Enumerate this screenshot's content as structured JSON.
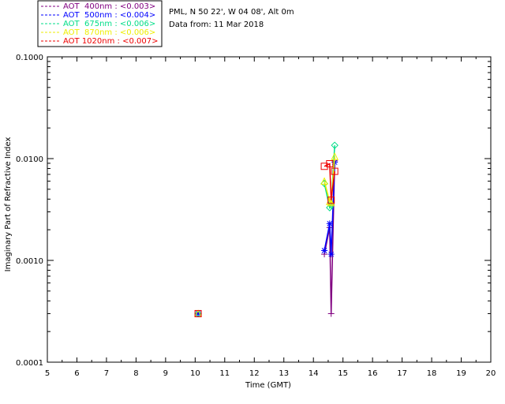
{
  "chart_data": {
    "type": "line",
    "header": {
      "location": "PML, N 50 22', W 04 08', Alt 0m",
      "date_line": "Data from: 11 Mar 2018"
    },
    "xlabel": "Time (GMT)",
    "ylabel": "Imaginary Part of Refractive Index",
    "xlim": [
      5,
      20
    ],
    "ylim": [
      0.0001,
      0.1
    ],
    "yscale": "log",
    "x_ticks": [
      "5",
      "6",
      "7",
      "8",
      "9",
      "10",
      "11",
      "12",
      "13",
      "14",
      "15",
      "16",
      "17",
      "18",
      "19",
      "20"
    ],
    "y_ticks": [
      {
        "value": 0.0001,
        "label": "0.0001"
      },
      {
        "value": 0.001,
        "label": "0.0010"
      },
      {
        "value": 0.01,
        "label": "0.0100"
      },
      {
        "value": 0.1,
        "label": "0.1000"
      }
    ],
    "grid": false,
    "legend": "top-left, outside plot",
    "series": [
      {
        "name": "AOT  400nm : <0.003>",
        "color": "#800080",
        "marker": "plus",
        "x": [
          14.37,
          14.55,
          14.6,
          14.72
        ],
        "y": [
          0.00115,
          0.0021,
          0.0003,
          0.0095
        ]
      },
      {
        "name": "AOT  500nm : <0.004>",
        "color": "#0000ff",
        "marker": "asterisk",
        "x": [
          14.37,
          14.55,
          14.6,
          14.72
        ],
        "y": [
          0.00125,
          0.0023,
          0.00115,
          0.0092
        ]
      },
      {
        "name": "AOT  675nm : <0.006>",
        "color": "#00dd88",
        "marker": "diamond",
        "x": [
          14.37,
          14.55,
          14.6,
          14.72
        ],
        "y": [
          0.0057,
          0.0033,
          0.0035,
          0.0135
        ]
      },
      {
        "name": "AOT  870nm : <0.006>",
        "color": "#eeee00",
        "marker": "triangle",
        "x": [
          14.37,
          14.55,
          14.6,
          14.72
        ],
        "y": [
          0.006,
          0.0038,
          0.0037,
          0.0105
        ]
      },
      {
        "name": "AOT 1020nm : <0.007>",
        "color": "#ee0000",
        "marker": "square",
        "x": [
          14.37,
          14.55,
          14.6,
          14.72
        ],
        "y": [
          0.0084,
          0.0089,
          0.0039,
          0.0075
        ]
      }
    ],
    "isolated_point": {
      "x": 10.1,
      "y": 0.0003
    }
  }
}
